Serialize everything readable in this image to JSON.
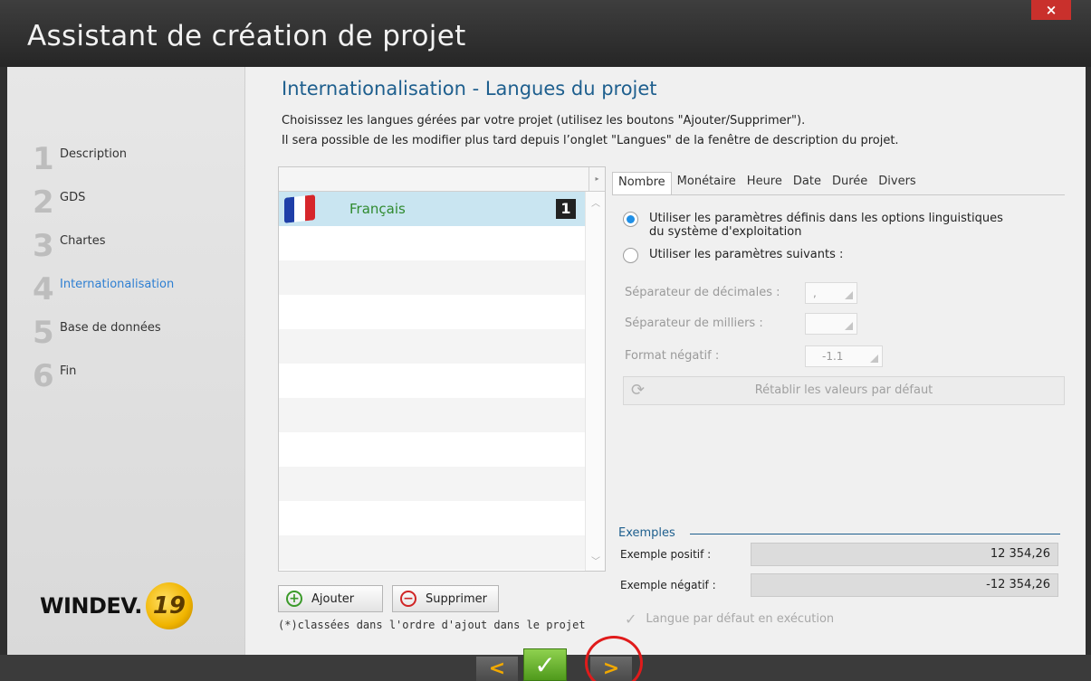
{
  "window": {
    "title": "Assistant de création de projet",
    "close_glyph": "×"
  },
  "steps": [
    {
      "num": "1",
      "label": "Description"
    },
    {
      "num": "2",
      "label": "GDS"
    },
    {
      "num": "3",
      "label": "Chartes"
    },
    {
      "num": "4",
      "label": "Internationalisation",
      "active": true
    },
    {
      "num": "5",
      "label": "Base de données"
    },
    {
      "num": "6",
      "label": "Fin"
    }
  ],
  "logo": {
    "word": "WINDEV.",
    "version": "19"
  },
  "page": {
    "heading": "Internationalisation - Langues du projet",
    "desc1": "Choisissez les langues gérées par votre projet (utilisez les boutons \"Ajouter/Supprimer\").",
    "desc2": "Il sera possible de les modifier plus tard depuis l’onglet \"Langues\" de la fenêtre de description du projet."
  },
  "languages": [
    {
      "name": "Français",
      "rank": "1",
      "flag_colors": [
        "#1f3fa8",
        "#ffffff",
        "#d6262b"
      ]
    }
  ],
  "buttons": {
    "add": "Ajouter",
    "remove": "Supprimer"
  },
  "note": "(*)classées dans l'ordre d'ajout dans le projet",
  "tabs": [
    "Nombre",
    "Monétaire",
    "Heure",
    "Date",
    "Durée",
    "Divers"
  ],
  "options": {
    "radio1_line1": "Utiliser les paramètres définis dans les options linguistiques",
    "radio1_line2": "du système d'exploitation",
    "radio2": "Utiliser les paramètres suivants :",
    "decimal_sep_label": "Séparateur de décimales :",
    "decimal_sep_value": ",",
    "thousand_sep_label": "Séparateur de milliers :",
    "thousand_sep_value": "",
    "neg_format_label": "Format négatif :",
    "neg_format_value": "-1.1",
    "reset_label": "Rétablir les valeurs par défaut"
  },
  "examples": {
    "title": "Exemples",
    "positive_label": "Exemple positif :",
    "positive_value": "12 354,26",
    "negative_label": "Exemple négatif :",
    "negative_value": "-12 354,26"
  },
  "default_lang_label": "Langue par défaut en exécution",
  "nav": {
    "prev": "<",
    "ok": "✓",
    "next": ">"
  },
  "colors": {
    "accent": "#1e5f8e",
    "active_step": "#2e7fd2",
    "highlight": "#e01b1b"
  }
}
